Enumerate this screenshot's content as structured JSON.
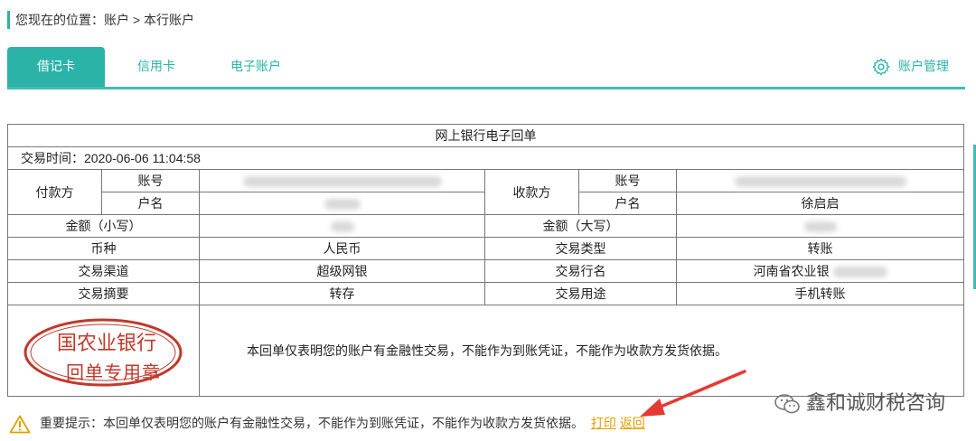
{
  "breadcrumb": {
    "prefix": "您现在的位置：",
    "path": "账户 > 本行账户"
  },
  "tabs": [
    {
      "label": "借记卡"
    },
    {
      "label": "信用卡"
    },
    {
      "label": "电子账户"
    }
  ],
  "account_management": {
    "label": "账户管理",
    "icon": "gear-icon"
  },
  "receipt": {
    "title": "网上银行电子回单",
    "trade_time_label": "交易时间：",
    "trade_time": "2020-06-06 11:04:58",
    "payer_label": "付款方",
    "payee_label": "收款方",
    "account_no_label": "账号",
    "account_name_label": "户名",
    "payee_name": "徐启启",
    "amount_small_label": "金额（小写）",
    "amount_large_label": "金额（大写）",
    "currency_label": "币种",
    "currency": "人民币",
    "trade_type_label": "交易类型",
    "trade_type": "转账",
    "channel_label": "交易渠道",
    "channel": "超级网银",
    "bank_label": "交易行名",
    "bank_name": "河南省农业银",
    "summary_label": "交易摘要",
    "summary": "转存",
    "purpose_label": "交易用途",
    "purpose": "手机转账",
    "stamp": {
      "line1": "国农业银行",
      "line2": "回单专用章"
    },
    "notice": "本回单仅表明您的账户有金融性交易，不能作为到账凭证，不能作为收款方发货依据。"
  },
  "tip": {
    "label": "重要提示：本回单仅表明您的账户有金融性交易，不能作为到账凭证，不能作为收款方发货依据。",
    "print": "打印",
    "back": "返回"
  },
  "watermark": "鑫和诚财税咨询",
  "colors": {
    "accent": "#2bb3a8",
    "link": "#e0a000",
    "stamp": "#c0392b",
    "arrow": "#e53935"
  }
}
